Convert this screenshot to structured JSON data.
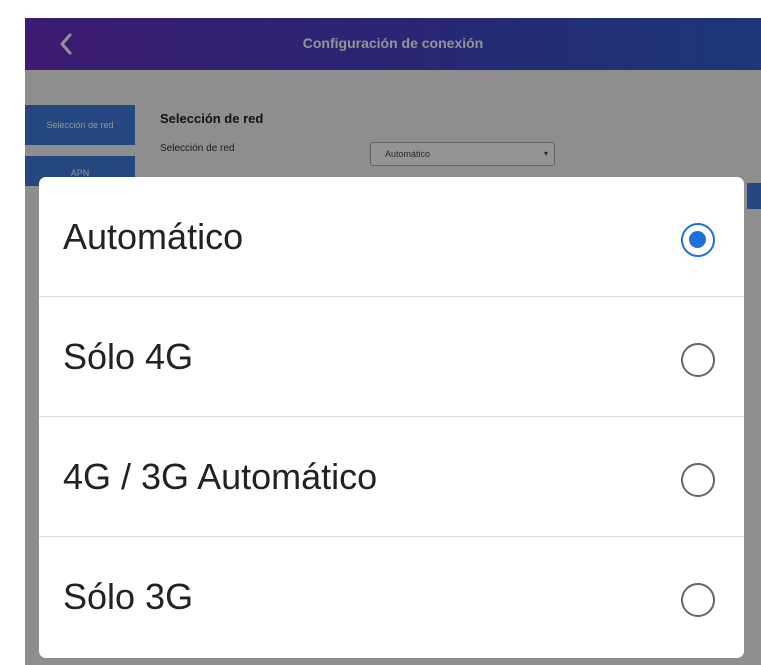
{
  "header": {
    "title": "Configuración de conexión",
    "back_icon": "chevron-left-icon"
  },
  "sidebar": {
    "items": [
      {
        "label": "Selección de red",
        "active": true
      },
      {
        "label": "APN",
        "active": false
      }
    ]
  },
  "content": {
    "section_title": "Selección de red",
    "field_label": "Selección de red",
    "select_value": "Automático"
  },
  "dialog": {
    "options": [
      {
        "label": "Automático",
        "selected": true
      },
      {
        "label": "Sólo 4G",
        "selected": false
      },
      {
        "label": "4G / 3G Automático",
        "selected": false
      },
      {
        "label": "Sólo 3G",
        "selected": false
      }
    ]
  },
  "colors": {
    "header_gradient_start": "#6a2fc6",
    "header_gradient_end": "#2f5ed0",
    "accent": "#1e6fe0",
    "tab_active": "#3d7ad9"
  }
}
